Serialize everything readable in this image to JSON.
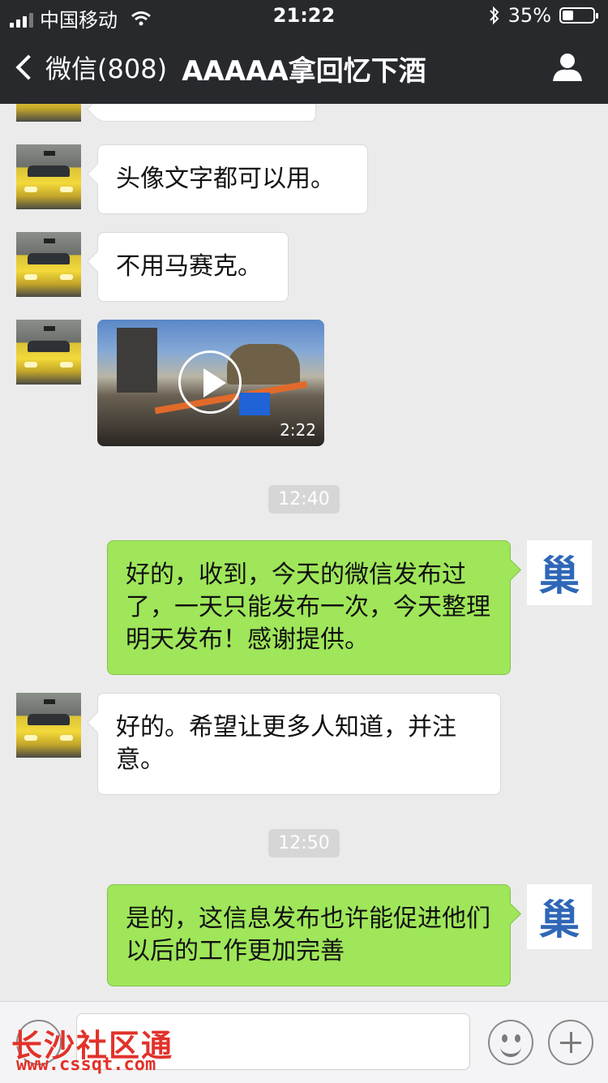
{
  "status_bar": {
    "carrier": "中国移动",
    "time": "21:22",
    "battery": "35%"
  },
  "nav": {
    "back_label": "微信(808)",
    "title": "AAAAA拿回忆下酒"
  },
  "messages": [
    {
      "side": "left",
      "text": "头像文字都可以用。"
    },
    {
      "side": "left",
      "text": "不用马赛克。"
    },
    {
      "side": "left",
      "type": "video",
      "duration": "2:22"
    },
    {
      "type": "timestamp",
      "text": "12:40"
    },
    {
      "side": "right",
      "text": "好的，收到，今天的微信发布过了，一天只能发布一次，今天整理明天发布！感谢提供。"
    },
    {
      "side": "left",
      "text": "好的。希望让更多人知道，并注意。"
    },
    {
      "type": "timestamp",
      "text": "12:50"
    },
    {
      "side": "right",
      "text": "是的，这信息发布也许能促进他们以后的工作更加完善"
    }
  ],
  "self_avatar_char": "巢",
  "watermark": {
    "name": "长沙社区通",
    "url": "www.cssqt.com"
  }
}
